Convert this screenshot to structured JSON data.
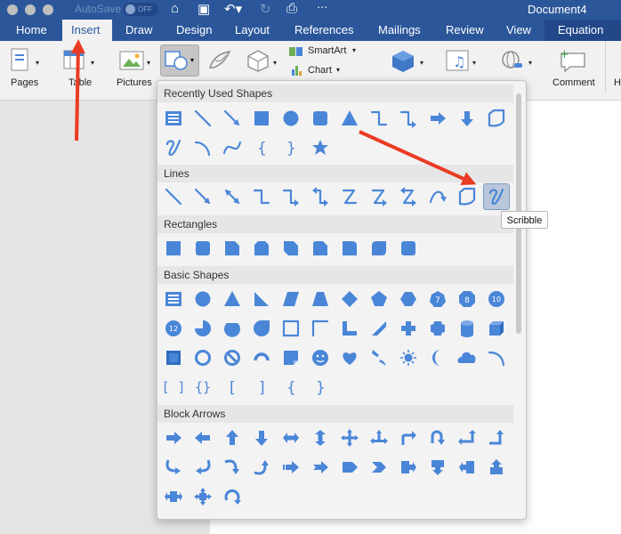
{
  "titlebar": {
    "autosave_label": "AutoSave",
    "autosave_state": "OFF",
    "document_title": "Document4",
    "icons": [
      "home-icon",
      "save-icon",
      "undo-icon",
      "redo-icon",
      "print-icon",
      "more-icon"
    ]
  },
  "tabs": [
    "Home",
    "Insert",
    "Draw",
    "Design",
    "Layout",
    "References",
    "Mailings",
    "Review",
    "View",
    "Equation"
  ],
  "active_tab": "Insert",
  "ribbon": {
    "pages_label": "Pages",
    "table_label": "Table",
    "pictures_label": "Pictures",
    "smartart_label": "SmartArt",
    "chart_label": "Chart",
    "comment_label": "Comment",
    "header_label_partial": "H"
  },
  "shapes_panel": {
    "sections": [
      "Recently Used Shapes",
      "Lines",
      "Rectangles",
      "Basic Shapes",
      "Block Arrows"
    ],
    "selected_shape": "Scribble",
    "tooltip": "Scribble"
  },
  "colors": {
    "titlebar": "#2b579a",
    "shape_fill": "#4a86d8",
    "annotation_arrow": "#ea3b24",
    "selected_bg": "#b9c7da"
  }
}
